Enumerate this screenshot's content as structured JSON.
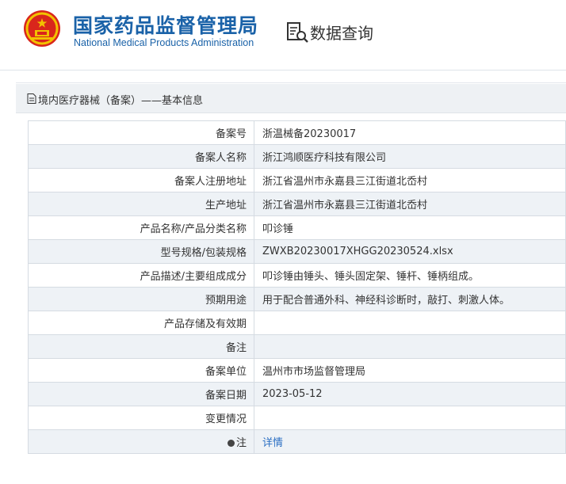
{
  "header": {
    "title_cn": "国家药品监督管理局",
    "title_en": "National Medical Products Administration",
    "query_title": "数据查询",
    "emblem_icon": "national-emblem-icon",
    "query_icon": "document-search-icon"
  },
  "panel": {
    "title": "境内医疗器械（备案）——基本信息",
    "title_icon": "document-icon"
  },
  "record": {
    "rows": [
      {
        "label": "备案号",
        "value": "浙温械备20230017"
      },
      {
        "label": "备案人名称",
        "value": "浙江鸿顺医疗科技有限公司"
      },
      {
        "label": "备案人注册地址",
        "value": "浙江省温州市永嘉县三江街道北岙村"
      },
      {
        "label": "生产地址",
        "value": "浙江省温州市永嘉县三江街道北岙村"
      },
      {
        "label": "产品名称/产品分类名称",
        "value": "叩诊锤"
      },
      {
        "label": "型号规格/包装规格",
        "value": "ZWXB20230017XHGG20230524.xlsx"
      },
      {
        "label": "产品描述/主要组成成分",
        "value": "叩诊锤由锤头、锤头固定架、锤杆、锤柄组成。"
      },
      {
        "label": "预期用途",
        "value": "用于配合普通外科、神经科诊断时，敲打、刺激人体。"
      },
      {
        "label": "产品存储及有效期",
        "value": ""
      },
      {
        "label": "备注",
        "value": ""
      },
      {
        "label": "备案单位",
        "value": "温州市市场监督管理局"
      },
      {
        "label": "备案日期",
        "value": "2023-05-12"
      },
      {
        "label": "变更情况",
        "value": ""
      }
    ],
    "note_label": "注",
    "note_icon": "pin-icon",
    "note_link": "详情"
  },
  "colors": {
    "brand_blue": "#1a62a8",
    "link_blue": "#2b6fc3",
    "row_alt": "#eef2f6",
    "border": "#d5dbe2"
  }
}
